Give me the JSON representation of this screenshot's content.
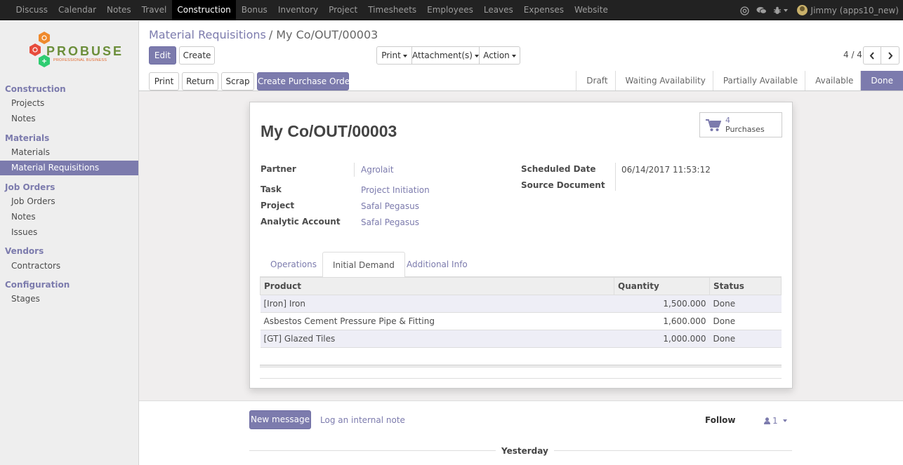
{
  "topbar": {
    "menu": [
      "Discuss",
      "Calendar",
      "Notes",
      "Travel",
      "Construction",
      "Bonus",
      "Inventory",
      "Project",
      "Timesheets",
      "Employees",
      "Leaves",
      "Expenses",
      "Website"
    ],
    "active": "Construction",
    "user": "Jimmy (apps10_new)"
  },
  "logo": {
    "word": "PROBUSE",
    "tagline": "PROFESSIONAL BUSINESS"
  },
  "sidebar": {
    "sections": [
      {
        "title": "Construction",
        "items": [
          "Projects",
          "Notes"
        ]
      },
      {
        "title": "Materials",
        "items": [
          "Materials",
          "Material Requisitions"
        ]
      },
      {
        "title": "Job Orders",
        "items": [
          "Job Orders",
          "Notes",
          "Issues"
        ]
      },
      {
        "title": "Vendors",
        "items": [
          "Contractors"
        ]
      },
      {
        "title": "Configuration",
        "items": [
          "Stages"
        ]
      }
    ],
    "active_item": "Material Requisitions"
  },
  "breadcrumb": {
    "parent": "Material Requisitions",
    "separator": "/",
    "current": "My Co/OUT/00003"
  },
  "buttons": {
    "edit": "Edit",
    "create": "Create",
    "print_menu": "Print",
    "attachments_menu": "Attachment(s)",
    "action_menu": "Action",
    "print": "Print",
    "return": "Return",
    "scrap": "Scrap",
    "create_po": "Create Purchase Order"
  },
  "pager": {
    "value": "4 / 4"
  },
  "statusbar": {
    "stages": [
      "Draft",
      "Waiting Availability",
      "Partially Available",
      "Available",
      "Done"
    ],
    "current": "Done"
  },
  "record": {
    "title": "My Co/OUT/00003",
    "smart_button": {
      "count": "4",
      "label": "Purchases"
    },
    "fields": {
      "partner_label": "Partner",
      "partner": "Agrolait",
      "task_label": "Task",
      "task": "Project Initiation",
      "project_label": "Project",
      "project": "Safal Pegasus",
      "analytic_label": "Analytic Account",
      "analytic": "Safal Pegasus",
      "scheduled_label": "Scheduled Date",
      "scheduled": "06/14/2017 11:53:12",
      "source_label": "Source Document",
      "source": ""
    },
    "tabs": [
      "Operations",
      "Initial Demand",
      "Additional Info"
    ],
    "active_tab": "Initial Demand",
    "table": {
      "headers": [
        "Product",
        "Quantity",
        "Status"
      ],
      "rows": [
        [
          "[Iron] Iron",
          "1,500.000",
          "Done"
        ],
        [
          "Asbestos Cement Pressure Pipe & Fitting",
          "1,600.000",
          "Done"
        ],
        [
          "[GT] Glazed Tiles",
          "1,000.000",
          "Done"
        ]
      ]
    }
  },
  "chatter": {
    "new_message": "New message",
    "log_note": "Log an internal note",
    "follow": "Follow",
    "followers": "1",
    "day": "Yesterday"
  },
  "colors": {
    "brand": "#7c7bad",
    "topbar": "#222222",
    "sidebar": "#eeeeee"
  }
}
